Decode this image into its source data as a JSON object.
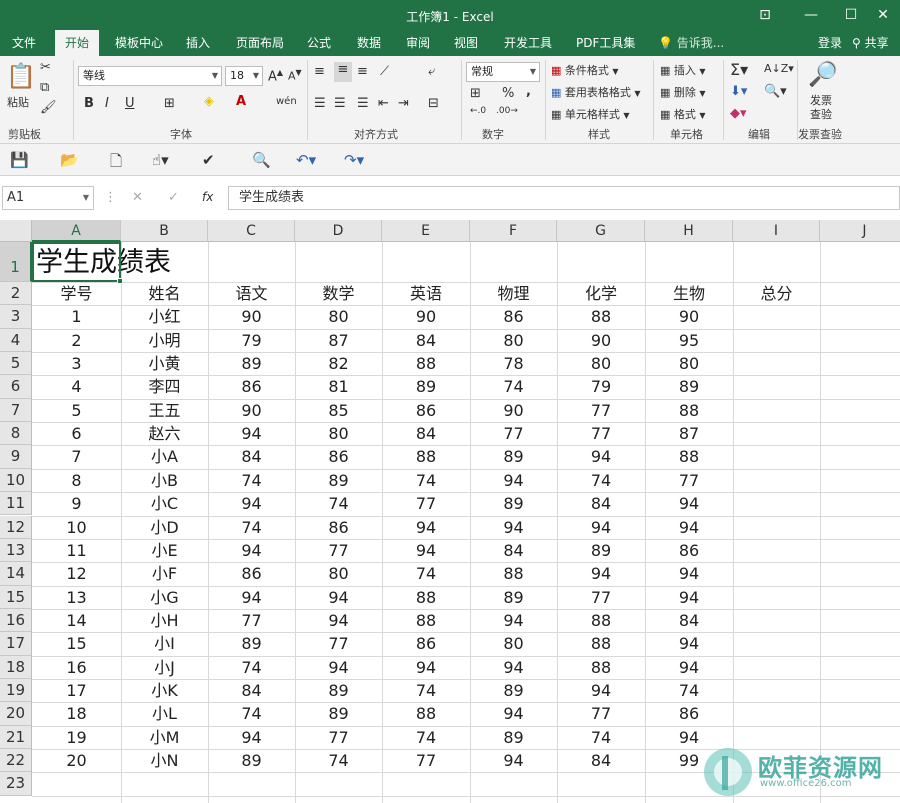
{
  "window": {
    "title": "工作簿1 - Excel",
    "buttons": {
      "ribbon_display": "⊡",
      "minimize": "—",
      "maximize": "☐",
      "close": "✕"
    }
  },
  "menu": {
    "tabs": [
      "文件",
      "开始",
      "模板中心",
      "插入",
      "页面布局",
      "公式",
      "数据",
      "审阅",
      "视图",
      "开发工具",
      "PDF工具集"
    ],
    "active_tab": "开始",
    "tell_me": "告诉我...",
    "login": "登录",
    "share": "共享"
  },
  "ribbon": {
    "clipboard": {
      "paste": "粘贴",
      "label": "剪贴板"
    },
    "font": {
      "name": "等线",
      "size": "18",
      "bold": "B",
      "italic": "I",
      "underline": "U",
      "label": "字体"
    },
    "alignment": {
      "label": "对齐方式"
    },
    "number": {
      "format": "常规",
      "percent": "%",
      "comma": ",",
      "label": "数字"
    },
    "styles": {
      "conditional": "条件格式",
      "table": "套用表格格式",
      "cell": "单元格样式",
      "label": "样式"
    },
    "cells": {
      "insert": "插入",
      "delete": "删除",
      "format": "格式",
      "label": "单元格"
    },
    "editing": {
      "label": "编辑"
    },
    "invoice": {
      "button_line1": "发票",
      "button_line2": "查验",
      "label": "发票查验"
    }
  },
  "formula_bar": {
    "name_box": "A1",
    "cancel": "✕",
    "enter": "✓",
    "fx": "fx",
    "content": "学生成绩表"
  },
  "sheet": {
    "columns": [
      "A",
      "B",
      "C",
      "D",
      "E",
      "F",
      "G",
      "H",
      "I",
      "J"
    ],
    "row_numbers": [
      "1",
      "2",
      "3",
      "4",
      "5",
      "6",
      "7",
      "8",
      "9",
      "10",
      "11",
      "12",
      "13",
      "14",
      "15",
      "16",
      "17",
      "18",
      "19",
      "20",
      "21",
      "22",
      "23"
    ],
    "title": "学生成绩表",
    "headers": [
      "学号",
      "姓名",
      "语文",
      "数学",
      "英语",
      "物理",
      "化学",
      "生物",
      "总分"
    ],
    "rows": [
      [
        "1",
        "小红",
        "90",
        "80",
        "90",
        "86",
        "88",
        "90"
      ],
      [
        "2",
        "小明",
        "79",
        "87",
        "84",
        "80",
        "90",
        "95"
      ],
      [
        "3",
        "小黄",
        "89",
        "82",
        "88",
        "78",
        "80",
        "80"
      ],
      [
        "4",
        "李四",
        "86",
        "81",
        "89",
        "74",
        "79",
        "89"
      ],
      [
        "5",
        "王五",
        "90",
        "85",
        "86",
        "90",
        "77",
        "88"
      ],
      [
        "6",
        "赵六",
        "94",
        "80",
        "84",
        "77",
        "77",
        "87"
      ],
      [
        "7",
        "小A",
        "84",
        "86",
        "88",
        "89",
        "94",
        "88"
      ],
      [
        "8",
        "小B",
        "74",
        "89",
        "74",
        "94",
        "74",
        "77"
      ],
      [
        "9",
        "小C",
        "94",
        "74",
        "77",
        "89",
        "84",
        "94"
      ],
      [
        "10",
        "小D",
        "74",
        "86",
        "94",
        "94",
        "94",
        "94"
      ],
      [
        "11",
        "小E",
        "94",
        "77",
        "94",
        "84",
        "89",
        "86"
      ],
      [
        "12",
        "小F",
        "86",
        "80",
        "74",
        "88",
        "94",
        "94"
      ],
      [
        "13",
        "小G",
        "94",
        "94",
        "88",
        "89",
        "77",
        "94"
      ],
      [
        "14",
        "小H",
        "77",
        "94",
        "88",
        "94",
        "88",
        "84"
      ],
      [
        "15",
        "小I",
        "89",
        "77",
        "86",
        "80",
        "88",
        "94"
      ],
      [
        "16",
        "小J",
        "74",
        "94",
        "94",
        "94",
        "88",
        "94"
      ],
      [
        "17",
        "小K",
        "84",
        "89",
        "74",
        "89",
        "94",
        "74"
      ],
      [
        "18",
        "小L",
        "74",
        "89",
        "88",
        "94",
        "77",
        "86"
      ],
      [
        "19",
        "小M",
        "94",
        "77",
        "74",
        "89",
        "74",
        "94"
      ],
      [
        "20",
        "小N",
        "89",
        "74",
        "77",
        "94",
        "84",
        "99"
      ]
    ]
  },
  "watermark": {
    "text": "欧菲资源网",
    "url": "www.office26.com"
  },
  "colors": {
    "accent": "#217346",
    "watermark": "#36a59b"
  }
}
